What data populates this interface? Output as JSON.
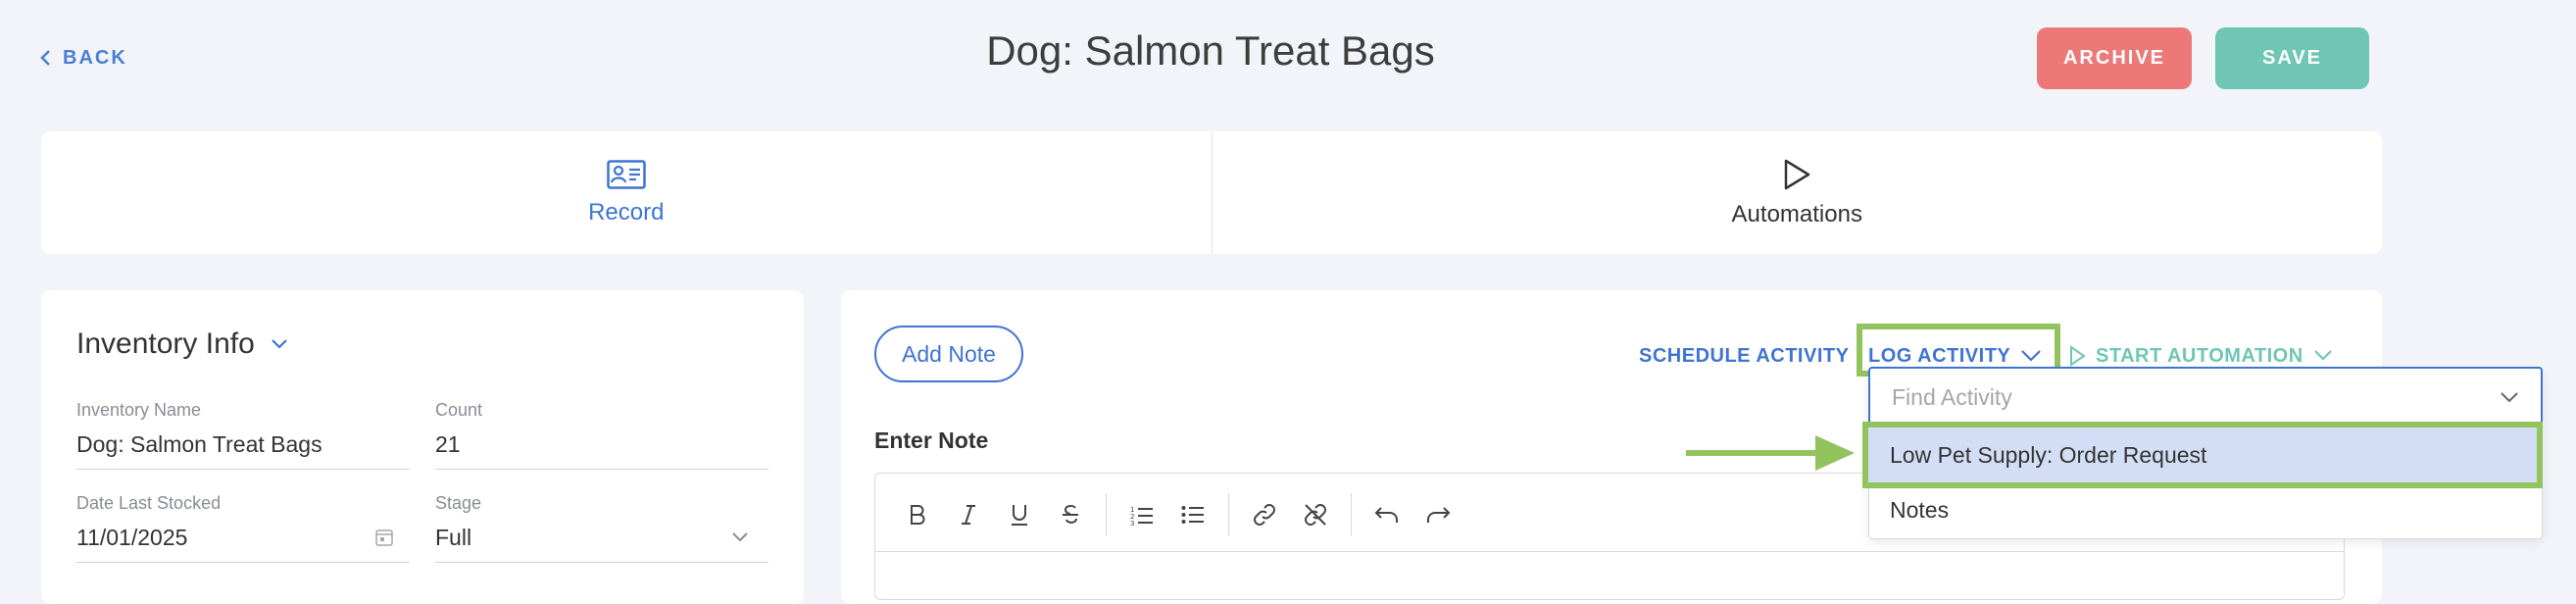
{
  "header": {
    "back_label": "BACK",
    "title": "Dog: Salmon Treat Bags",
    "archive_label": "ARCHIVE",
    "save_label": "SAVE"
  },
  "tabs": [
    {
      "label": "Record",
      "icon": "id-card-icon",
      "active": true
    },
    {
      "label": "Automations",
      "icon": "play-icon",
      "active": false
    }
  ],
  "inventory": {
    "title": "Inventory Info",
    "fields": {
      "name": {
        "label": "Inventory Name",
        "value": "Dog: Salmon Treat Bags"
      },
      "count": {
        "label": "Count",
        "value": "21"
      },
      "date": {
        "label": "Date Last Stocked",
        "value": "11/01/2025"
      },
      "stage": {
        "label": "Stage",
        "value": "Full"
      }
    }
  },
  "activity": {
    "add_note_label": "Add Note",
    "schedule_label": "SCHEDULE ACTIVITY",
    "log_label": "LOG ACTIVITY",
    "start_label": "START AUTOMATION",
    "enter_note_label": "Enter Note",
    "find_placeholder": "Find Activity",
    "options": [
      "Low Pet Supply: Order Request",
      "Notes"
    ]
  },
  "colors": {
    "accent": "#3f74d2",
    "archive": "#ec7977",
    "save": "#6fc6b4",
    "highlight": "#93c35d",
    "selected_option": "#d3ddf5",
    "start_automation": "#6fc6b4"
  }
}
